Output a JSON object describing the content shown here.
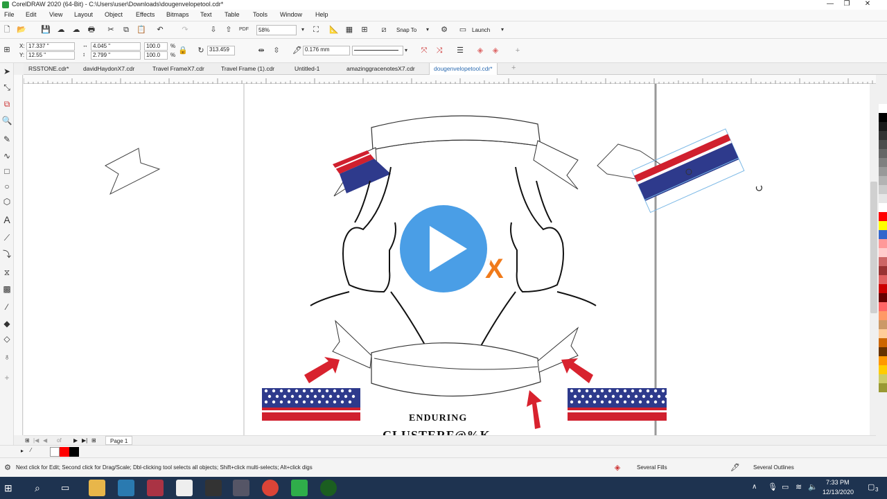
{
  "window": {
    "title": "CorelDRAW 2020 (64-Bit) - C:\\Users\\user\\Downloads\\dougenvelopetool.cdr*"
  },
  "menu": [
    "File",
    "Edit",
    "View",
    "Layout",
    "Object",
    "Effects",
    "Bitmaps",
    "Text",
    "Table",
    "Tools",
    "Window",
    "Help"
  ],
  "toolbar": {
    "zoom": "58%",
    "snap_to": "Snap To",
    "launch": "Launch"
  },
  "propbar": {
    "x": "17.337 \"",
    "y": "12.55 \"",
    "w": "4.045 \"",
    "h": "2.799 \"",
    "scale_w": "100.0",
    "scale_h": "100.0",
    "pct": "%",
    "rotation": "313.459",
    "outline_width": "0.176 mm",
    "x_label": "X:",
    "y_label": "Y:"
  },
  "doc_tabs": [
    "RSSTONE.cdr*",
    "davidHaydonX7.cdr",
    "Travel FrameX7.cdr",
    "Travel Frame (1).cdr",
    "Untitled-1",
    "amazinggracenotesX7.cdr",
    "dougenvelopetool.cdr*"
  ],
  "page_nav": {
    "of_label": "of",
    "page_label": "Page 1"
  },
  "artwork": {
    "text_line1": "ENDURING",
    "text_line2": "CLUSTERF@%K",
    "x_letter": "X"
  },
  "status": {
    "hint": "Next click for Edit; Second click for Drag/Scale; Dbl-clicking tool selects all objects; Shift+click multi-selects; Alt+click digs",
    "fill": "Several Fills",
    "outline": "Several Outlines"
  },
  "taskbar": {
    "time": "7:33 PM",
    "date": "12/13/2020",
    "notifications": "3"
  },
  "palette_colors": [
    "#ffffff",
    "#000000",
    "#1a1a1a",
    "#333333",
    "#4d4d4d",
    "#666666",
    "#808080",
    "#999999",
    "#b3b3b3",
    "#cccccc",
    "#e6e6e6",
    "#ffffff",
    "#ff0000",
    "#ffff00",
    "#3366cc",
    "#ff9999",
    "#ffcccc",
    "#cc6666",
    "#993333",
    "#e06060",
    "#cc0000",
    "#660000",
    "#ff6666",
    "#ff9966",
    "#cc9966",
    "#ffcc99",
    "#cc6600",
    "#663300",
    "#ff9900",
    "#ffcc00",
    "#cccc66",
    "#999933"
  ],
  "colors": {
    "accent_red": "#d0202e",
    "flag_blue": "#2e3a8c",
    "play_blue": "#4a9ee6",
    "x_orange": "#f07a1a"
  }
}
